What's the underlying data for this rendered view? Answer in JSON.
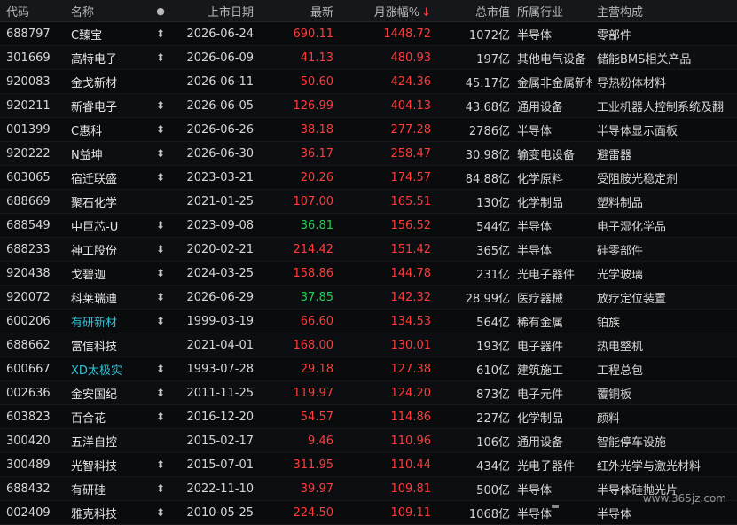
{
  "columns": {
    "code": "代码",
    "name": "名称",
    "flag": "●",
    "date": "上市日期",
    "price": "最新",
    "change": "月涨幅%",
    "change_arrow": "↓",
    "cap": "总市值",
    "industry": "所属行业",
    "business": "主营构成"
  },
  "rows": [
    {
      "code": "688797",
      "name": "C臻宝",
      "flag": "⬍",
      "date": "2026-06-24",
      "price": "690.11",
      "price_color": "red",
      "change": "1448.72",
      "cap": "1072亿",
      "industry": "半导体",
      "business": "零部件"
    },
    {
      "code": "301669",
      "name": "高特电子",
      "flag": "⬍",
      "date": "2026-06-09",
      "price": "41.13",
      "price_color": "red",
      "change": "480.93",
      "cap": "197亿",
      "industry": "其他电气设备",
      "business": "储能BMS相关产品"
    },
    {
      "code": "920083",
      "name": "金戈新材",
      "flag": "",
      "date": "2026-06-11",
      "price": "50.60",
      "price_color": "red",
      "change": "424.36",
      "cap": "45.17亿",
      "industry": "金属非金属新材",
      "business": "导热粉体材料"
    },
    {
      "code": "920211",
      "name": "新睿电子",
      "flag": "⬍",
      "date": "2026-06-05",
      "price": "126.99",
      "price_color": "red",
      "change": "404.13",
      "cap": "43.68亿",
      "industry": "通用设备",
      "business": "工业机器人控制系统及翻"
    },
    {
      "code": "001399",
      "name": "C惠科",
      "flag": "⬍",
      "date": "2026-06-26",
      "price": "38.18",
      "price_color": "red",
      "change": "277.28",
      "cap": "2786亿",
      "industry": "半导体",
      "business": "半导体显示面板"
    },
    {
      "code": "920222",
      "name": "N益坤",
      "flag": "⬍",
      "date": "2026-06-30",
      "price": "36.17",
      "price_color": "red",
      "change": "258.47",
      "cap": "30.98亿",
      "industry": "输变电设备",
      "business": "避雷器"
    },
    {
      "code": "603065",
      "name": "宿迁联盛",
      "flag": "⬍",
      "date": "2023-03-21",
      "price": "20.26",
      "price_color": "red",
      "change": "174.57",
      "cap": "84.88亿",
      "industry": "化学原料",
      "business": "受阻胺光稳定剂"
    },
    {
      "code": "688669",
      "name": "聚石化学",
      "flag": "",
      "date": "2021-01-25",
      "price": "107.00",
      "price_color": "red",
      "change": "165.51",
      "cap": "130亿",
      "industry": "化学制品",
      "business": "塑料制品"
    },
    {
      "code": "688549",
      "name": "中巨芯-U",
      "flag": "⬍",
      "date": "2023-09-08",
      "price": "36.81",
      "price_color": "green",
      "change": "156.52",
      "cap": "544亿",
      "industry": "半导体",
      "business": "电子湿化学品"
    },
    {
      "code": "688233",
      "name": "神工股份",
      "flag": "⬍",
      "date": "2020-02-21",
      "price": "214.42",
      "price_color": "red",
      "change": "151.42",
      "cap": "365亿",
      "industry": "半导体",
      "business": "硅零部件"
    },
    {
      "code": "920438",
      "name": "戈碧迦",
      "flag": "⬍",
      "date": "2024-03-25",
      "price": "158.86",
      "price_color": "red",
      "change": "144.78",
      "cap": "231亿",
      "industry": "光电子器件",
      "business": "光学玻璃"
    },
    {
      "code": "920072",
      "name": "科莱瑞迪",
      "flag": "⬍",
      "date": "2026-06-29",
      "price": "37.85",
      "price_color": "green",
      "change": "142.32",
      "cap": "28.99亿",
      "industry": "医疗器械",
      "business": "放疗定位装置"
    },
    {
      "code": "600206",
      "name": "有研新材",
      "name_color": "cyan",
      "flag": "⬍",
      "date": "1999-03-19",
      "price": "66.60",
      "price_color": "red",
      "change": "134.53",
      "cap": "564亿",
      "industry": "稀有金属",
      "business": "铂族"
    },
    {
      "code": "688662",
      "name": "富信科技",
      "flag": "",
      "date": "2021-04-01",
      "price": "168.00",
      "price_color": "red",
      "change": "130.01",
      "cap": "193亿",
      "industry": "电子器件",
      "business": "热电整机"
    },
    {
      "code": "600667",
      "name": "XD太极实",
      "name_color": "cyan",
      "flag": "⬍",
      "date": "1993-07-28",
      "price": "29.18",
      "price_color": "red",
      "change": "127.38",
      "cap": "610亿",
      "industry": "建筑施工",
      "business": "工程总包"
    },
    {
      "code": "002636",
      "name": "金安国纪",
      "flag": "⬍",
      "date": "2011-11-25",
      "price": "119.97",
      "price_color": "red",
      "change": "124.20",
      "cap": "873亿",
      "industry": "电子元件",
      "business": "覆铜板"
    },
    {
      "code": "603823",
      "name": "百合花",
      "flag": "⬍",
      "date": "2016-12-20",
      "price": "54.57",
      "price_color": "red",
      "change": "114.86",
      "cap": "227亿",
      "industry": "化学制品",
      "business": "颜料"
    },
    {
      "code": "300420",
      "name": "五洋自控",
      "flag": "",
      "date": "2015-02-17",
      "price": "9.46",
      "price_color": "red",
      "change": "110.96",
      "cap": "106亿",
      "industry": "通用设备",
      "business": "智能停车设施"
    },
    {
      "code": "300489",
      "name": "光智科技",
      "flag": "⬍",
      "date": "2015-07-01",
      "price": "311.95",
      "price_color": "red",
      "change": "110.44",
      "cap": "434亿",
      "industry": "光电子器件",
      "business": "红外光学与激光材料"
    },
    {
      "code": "688432",
      "name": "有研硅",
      "flag": "⬍",
      "date": "2022-11-10",
      "price": "39.97",
      "price_color": "red",
      "change": "109.81",
      "cap": "500亿",
      "industry": "半导体",
      "business": "半导体硅抛光片"
    },
    {
      "code": "002409",
      "name": "雅克科技",
      "flag": "⬍",
      "date": "2010-05-25",
      "price": "224.50",
      "price_color": "red",
      "change": "109.11",
      "cap": "1068亿",
      "industry": "半导体",
      "business": "半导体"
    }
  ],
  "watermark": "www.365jz.com"
}
